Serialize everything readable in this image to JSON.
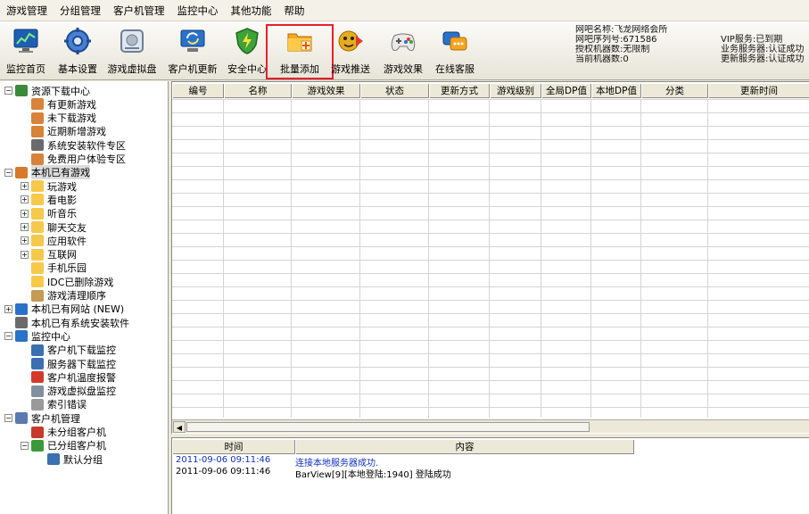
{
  "menu": [
    "游戏管理",
    "分组管理",
    "客户机管理",
    "监控中心",
    "其他功能",
    "帮助"
  ],
  "toolbar": [
    {
      "label": "监控首页",
      "icon": "monitor-chart-icon",
      "selected": false
    },
    {
      "label": "基本设置",
      "icon": "gear-icon",
      "selected": false
    },
    {
      "label": "游戏虚拟盘",
      "icon": "virtual-disk-icon",
      "selected": false
    },
    {
      "label": "客户机更新",
      "icon": "client-update-icon",
      "selected": false
    },
    {
      "label": "安全中心",
      "icon": "shield-icon",
      "selected": false
    },
    {
      "label": "批量添加",
      "icon": "folder-add-icon",
      "selected": true
    },
    {
      "label": "游戏推送",
      "icon": "game-push-icon",
      "selected": false
    },
    {
      "label": "游戏效果",
      "icon": "gamepad-icon",
      "selected": false
    },
    {
      "label": "在线客服",
      "icon": "online-service-icon",
      "selected": false
    }
  ],
  "info": {
    "rows": [
      {
        "left": "网吧名称:飞龙网络会所",
        "right": ""
      },
      {
        "left": "网吧序列号:671586",
        "right": "VIP服务:已到期"
      },
      {
        "left": "授权机器数:无限制",
        "right": "业务服务器:认证成功"
      },
      {
        "left": "当前机器数:0",
        "right": "更新服务器:认证成功"
      }
    ]
  },
  "tree": [
    {
      "label": "资源下载中心",
      "depth": 0,
      "expander": "−",
      "icon": "download-center-icon",
      "highlight": false
    },
    {
      "label": "有更新游戏",
      "depth": 1,
      "expander": "",
      "icon": "user-icon",
      "highlight": false
    },
    {
      "label": "未下载游戏",
      "depth": 1,
      "expander": "",
      "icon": "user-icon",
      "highlight": false
    },
    {
      "label": "近期新增游戏",
      "depth": 1,
      "expander": "",
      "icon": "user-icon",
      "highlight": false
    },
    {
      "label": "系统安装软件专区",
      "depth": 1,
      "expander": "",
      "icon": "grid-icon",
      "highlight": false
    },
    {
      "label": "免费用户体验专区",
      "depth": 1,
      "expander": "",
      "icon": "user-icon",
      "highlight": false
    },
    {
      "label": "本机已有游戏",
      "depth": 0,
      "expander": "−",
      "icon": "box-icon",
      "highlight": true
    },
    {
      "label": "玩游戏",
      "depth": 1,
      "expander": "+",
      "icon": "folder-icon",
      "highlight": false
    },
    {
      "label": "看电影",
      "depth": 1,
      "expander": "+",
      "icon": "folder-icon",
      "highlight": false
    },
    {
      "label": "听音乐",
      "depth": 1,
      "expander": "+",
      "icon": "folder-icon",
      "highlight": false
    },
    {
      "label": "聊天交友",
      "depth": 1,
      "expander": "+",
      "icon": "folder-icon",
      "highlight": false
    },
    {
      "label": "应用软件",
      "depth": 1,
      "expander": "+",
      "icon": "folder-icon",
      "highlight": false
    },
    {
      "label": "互联网",
      "depth": 1,
      "expander": "+",
      "icon": "folder-icon",
      "highlight": false
    },
    {
      "label": "手机乐园",
      "depth": 1,
      "expander": "",
      "icon": "folder-icon",
      "highlight": false
    },
    {
      "label": "IDC已删除游戏",
      "depth": 1,
      "expander": "",
      "icon": "folder-icon",
      "highlight": false
    },
    {
      "label": "游戏清理顺序",
      "depth": 1,
      "expander": "",
      "icon": "broom-icon",
      "highlight": false
    },
    {
      "label": "本机已有网站 (NEW)",
      "depth": 0,
      "expander": "+",
      "icon": "ie-icon",
      "highlight": false
    },
    {
      "label": "本机已有系统安装软件",
      "depth": 0,
      "expander": "",
      "icon": "grid-icon",
      "highlight": false
    },
    {
      "label": "监控中心",
      "depth": 0,
      "expander": "−",
      "icon": "monitor-icon",
      "highlight": false
    },
    {
      "label": "客户机下载监控",
      "depth": 1,
      "expander": "",
      "icon": "client-icon",
      "highlight": false
    },
    {
      "label": "服务器下载监控",
      "depth": 1,
      "expander": "",
      "icon": "server-icon",
      "highlight": false
    },
    {
      "label": "客户机温度报警",
      "depth": 1,
      "expander": "",
      "icon": "thermometer-icon",
      "highlight": false
    },
    {
      "label": "游戏虚拟盘监控",
      "depth": 1,
      "expander": "",
      "icon": "disk-icon",
      "highlight": false
    },
    {
      "label": "索引错误",
      "depth": 1,
      "expander": "",
      "icon": "index-error-icon",
      "highlight": false
    },
    {
      "label": "客户机管理",
      "depth": 0,
      "expander": "−",
      "icon": "clients-icon",
      "highlight": false
    },
    {
      "label": "未分组客户机",
      "depth": 1,
      "expander": "",
      "icon": "client-red-icon",
      "highlight": false
    },
    {
      "label": "已分组客户机",
      "depth": 1,
      "expander": "−",
      "icon": "client-green-icon",
      "highlight": false
    },
    {
      "label": "默认分组",
      "depth": 2,
      "expander": "",
      "icon": "computer-icon",
      "highlight": false
    }
  ],
  "grid": {
    "columns": [
      "编号",
      "名称",
      "游戏效果",
      "状态",
      "更新方式",
      "游戏级别",
      "全局DP值",
      "本地DP值",
      "分类",
      "更新时间"
    ],
    "rows": []
  },
  "log": {
    "columns": [
      "时间",
      "内容"
    ],
    "rows": [
      {
        "time": "2011-09-06 09:11:46",
        "content": "连接本地服务器成功.",
        "blue": true
      },
      {
        "time": "2011-09-06 09:11:46",
        "content": "BarView[9][本地登陆:1940] 登陆成功",
        "blue": false
      }
    ]
  },
  "colors": {
    "selection_outline": "#e8202a",
    "log_info": "#1030c0"
  }
}
